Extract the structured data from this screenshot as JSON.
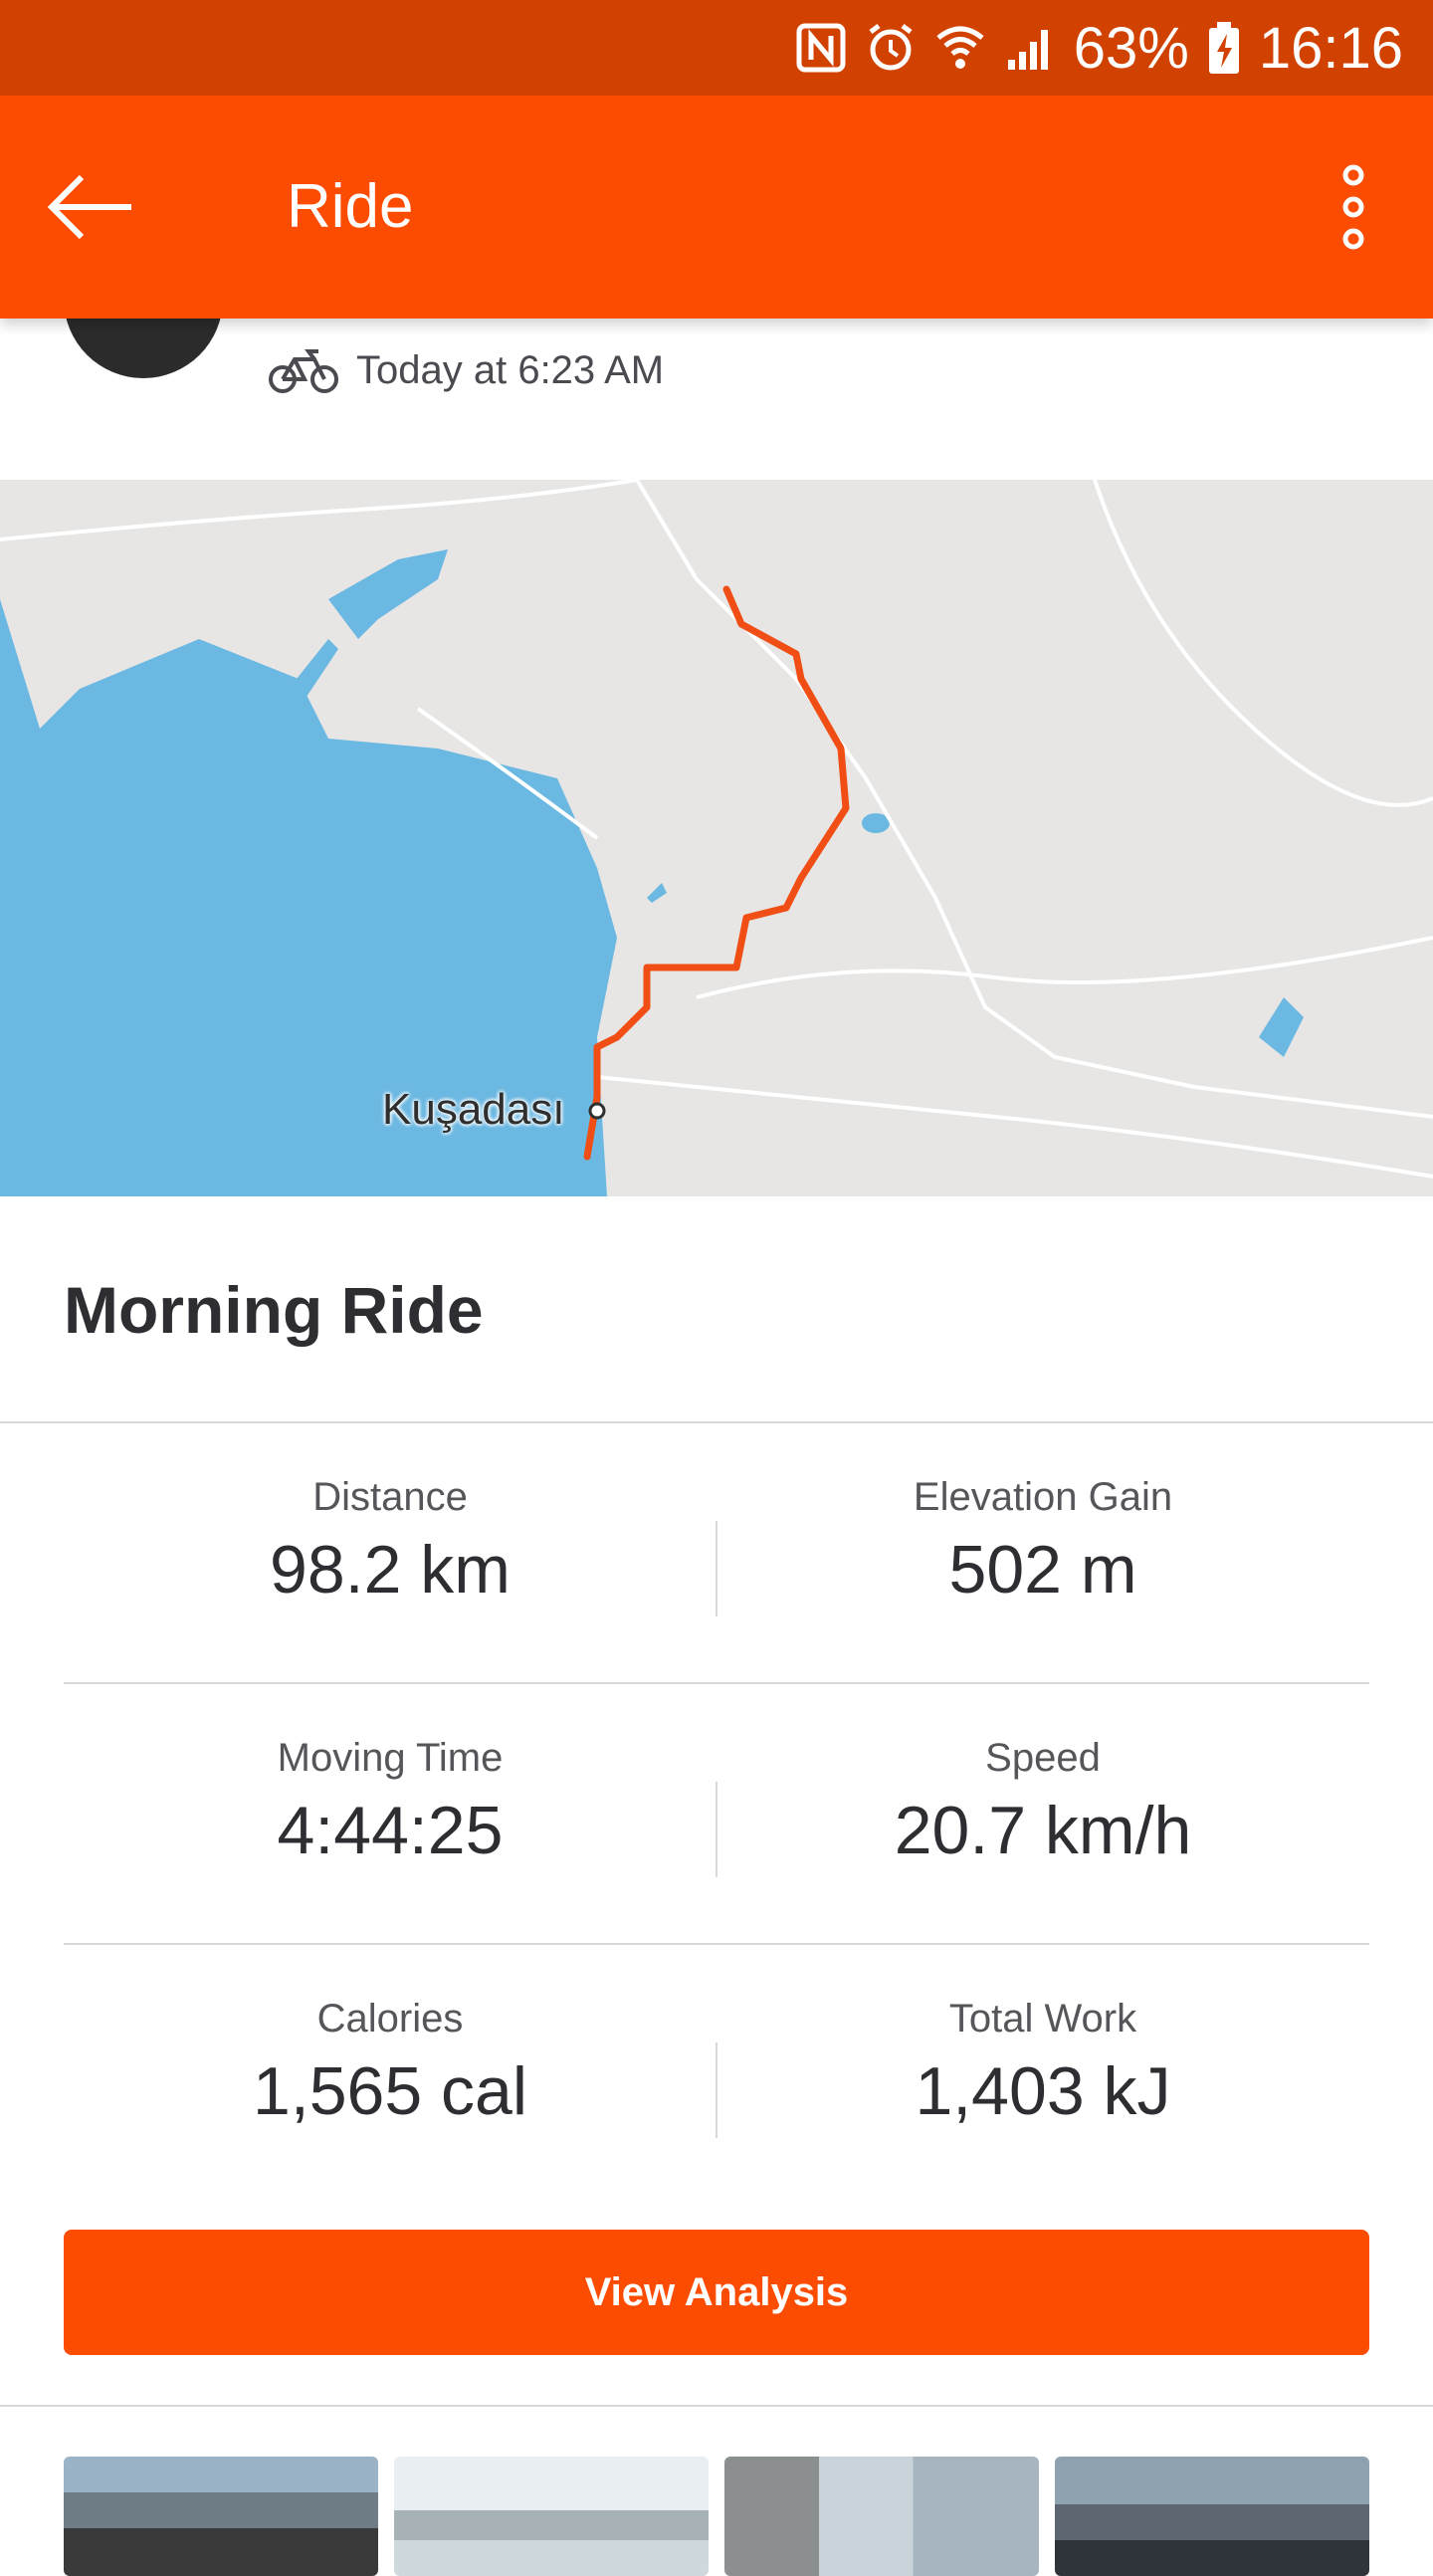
{
  "status_bar": {
    "battery": "63%",
    "time": "16:16",
    "icons": [
      "nfc-icon",
      "alarm-icon",
      "wifi-icon",
      "signal-icon",
      "battery-charging-icon"
    ]
  },
  "app_bar": {
    "title": "Ride",
    "back_icon": "arrow-left-icon",
    "menu_icon": "more-vertical-icon"
  },
  "activity": {
    "icon": "bicycle-icon",
    "time_text": "Today at 6:23 AM",
    "title": "Morning Ride"
  },
  "map": {
    "place_label": "Kuşadası",
    "route_color": "#f04e14",
    "water_color": "#6bb8e2",
    "land_color": "#e8e6e4"
  },
  "stats": [
    {
      "left": {
        "label": "Distance",
        "value": "98.2 km"
      },
      "right": {
        "label": "Elevation Gain",
        "value": "502 m"
      }
    },
    {
      "left": {
        "label": "Moving Time",
        "value": "4:44:25"
      },
      "right": {
        "label": "Speed",
        "value": "20.7 km/h"
      }
    },
    {
      "left": {
        "label": "Calories",
        "value": "1,565 cal"
      },
      "right": {
        "label": "Total Work",
        "value": "1,403 kJ"
      }
    }
  ],
  "buttons": {
    "view_analysis": "View Analysis"
  },
  "colors": {
    "accent": "#fc4c02",
    "status_bar": "#d14100"
  }
}
